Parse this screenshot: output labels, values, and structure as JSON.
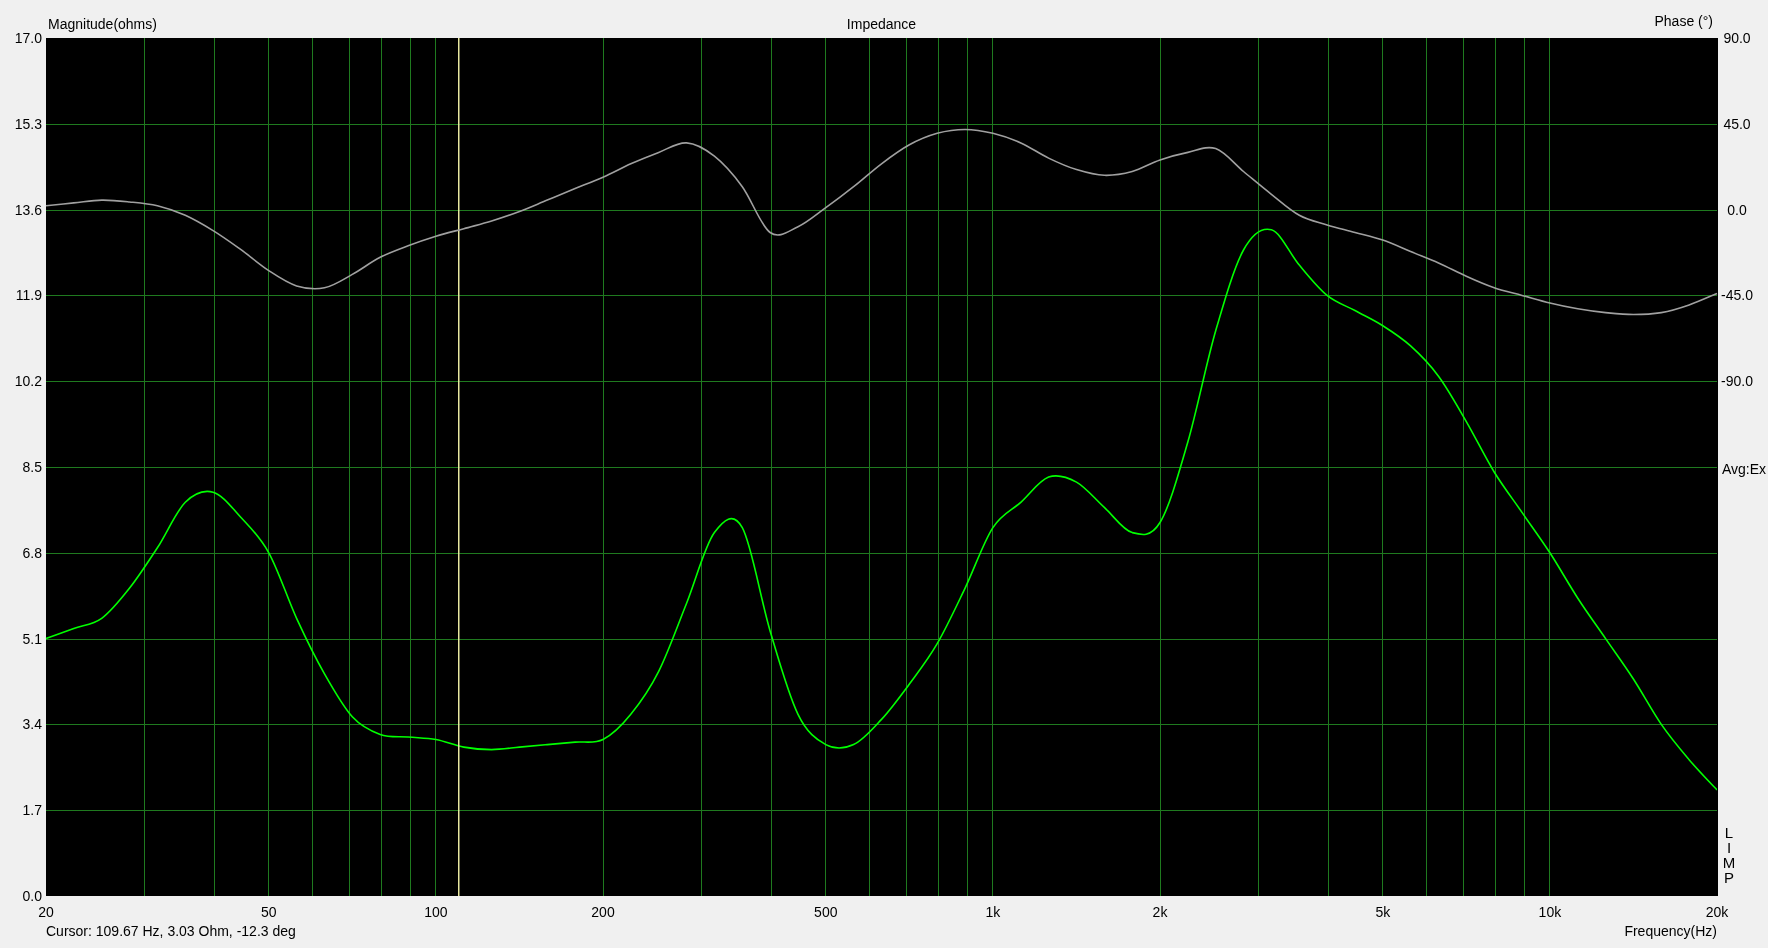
{
  "chart_data": {
    "type": "line",
    "title": "Impedance",
    "xlabel": "Frequency(Hz)",
    "ylabel": "Magnitude(ohms)",
    "categories": [
      "20",
      null,
      null,
      null,
      null,
      null,
      null,
      null,
      "50",
      null,
      null,
      null,
      null,
      null,
      "100",
      null,
      null,
      null,
      null,
      null,
      "200",
      null,
      null,
      null,
      null,
      null,
      null,
      null,
      "500",
      null,
      null,
      null,
      null,
      null,
      "1k",
      null,
      null,
      null,
      null,
      null,
      "2k",
      null,
      null,
      null,
      null,
      null,
      null,
      null,
      "5k",
      null,
      null,
      null,
      null,
      null,
      "10k",
      null,
      null,
      null,
      null,
      null,
      "20k"
    ],
    "series": [
      {
        "color": "#00ff00",
        "values": [
          5.1,
          5.3,
          5.5,
          6.1,
          6.9,
          7.8,
          8.0,
          7.5,
          6.8,
          5.5,
          4.4,
          3.55,
          3.2,
          3.15,
          3.1,
          2.95,
          2.9,
          2.95,
          3.0,
          3.05,
          3.1,
          3.6,
          4.45,
          5.8,
          7.2,
          7.3,
          5.25,
          3.6,
          3.0,
          3.0,
          3.5,
          4.2,
          5.0,
          6.1,
          7.3,
          7.8,
          8.3,
          8.2,
          7.7,
          7.2,
          7.4,
          9.0,
          11.2,
          12.8,
          13.2,
          12.5,
          11.9,
          11.6,
          11.3,
          10.9,
          10.3,
          9.4,
          8.4,
          7.6,
          6.8,
          5.9,
          5.1,
          4.3,
          3.4,
          2.7,
          2.1
        ]
      }
    ],
    "grid": true,
    "ylim": [
      0,
      17
    ],
    "yticks": [
      {
        "value": 17,
        "label": "17.0"
      },
      {
        "value": 15.3,
        "label": "15.3"
      },
      {
        "value": 13.6,
        "label": "13.6"
      },
      {
        "value": 11.9,
        "label": "11.9"
      },
      {
        "value": 10.2,
        "label": "10.2"
      },
      {
        "value": 8.5,
        "label": "8.5"
      },
      {
        "value": 6.8,
        "label": "6.8"
      },
      {
        "value": 5.1,
        "label": "5.1"
      },
      {
        "value": 3.4,
        "label": "3.4"
      },
      {
        "value": 1.7,
        "label": "1.7"
      },
      {
        "value": 0,
        "label": "0.0"
      }
    ]
  },
  "cursor": {
    "level": 0.2464
  },
  "phase_axis": {
    "note": "Avg:Ex",
    "chart_data": {
      "type": "line",
      "ylabel": "Phase (°)",
      "categories": [
        null,
        null,
        null,
        null,
        null,
        null,
        null,
        null,
        null,
        null,
        null,
        null,
        null,
        null,
        null,
        null,
        null,
        null,
        null,
        null,
        null,
        null,
        null,
        null,
        null,
        null,
        null,
        null,
        null,
        null,
        null,
        null,
        null,
        null,
        null,
        null,
        null,
        null,
        null,
        null,
        null,
        null,
        null,
        null,
        null,
        null,
        null,
        null,
        null,
        null,
        null,
        null,
        null,
        null,
        null,
        null,
        null,
        null,
        null,
        null,
        null
      ],
      "series": [
        {
          "color": "#a0a0a0",
          "values": [
            2,
            3.5,
            5,
            4,
            2,
            -3,
            -11,
            -21,
            -32,
            -40,
            -41,
            -34,
            -25,
            -19,
            -14,
            -10,
            -6,
            -1,
            5,
            11,
            17,
            24,
            30,
            35,
            28,
            12,
            -12,
            -9,
            1,
            12,
            24,
            34,
            40,
            42,
            40,
            35,
            27,
            21,
            18,
            20,
            26,
            30,
            32,
            20,
            8,
            -3,
            -8,
            -12,
            -16,
            -22,
            -28,
            -35,
            -41,
            -45,
            -49,
            -52,
            -54,
            -55,
            -54,
            -50,
            -44
          ]
        }
      ],
      "ylim": [
        -360,
        90
      ],
      "yticks": [
        {
          "value": 90,
          "label": "90.0"
        },
        {
          "value": 45,
          "label": "45.0"
        },
        {
          "value": 0,
          "label": "0.0"
        },
        {
          "value": -45,
          "label": "-45.0"
        },
        {
          "value": -90,
          "label": "-90.0"
        }
      ]
    }
  },
  "logo": "LIMP",
  "cursor_readout": "Cursor: 109.67 Hz, 3.03 Ohm, -12.3 deg"
}
